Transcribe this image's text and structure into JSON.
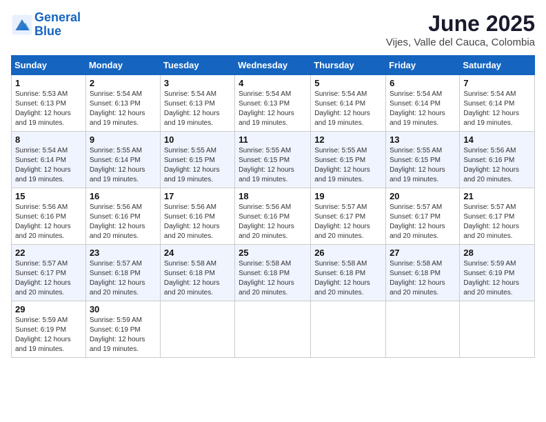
{
  "header": {
    "logo_line1": "General",
    "logo_line2": "Blue",
    "month": "June 2025",
    "location": "Vijes, Valle del Cauca, Colombia"
  },
  "weekdays": [
    "Sunday",
    "Monday",
    "Tuesday",
    "Wednesday",
    "Thursday",
    "Friday",
    "Saturday"
  ],
  "weeks": [
    [
      {
        "day": "1",
        "sunrise": "Sunrise: 5:53 AM",
        "sunset": "Sunset: 6:13 PM",
        "daylight": "Daylight: 12 hours and 19 minutes."
      },
      {
        "day": "2",
        "sunrise": "Sunrise: 5:54 AM",
        "sunset": "Sunset: 6:13 PM",
        "daylight": "Daylight: 12 hours and 19 minutes."
      },
      {
        "day": "3",
        "sunrise": "Sunrise: 5:54 AM",
        "sunset": "Sunset: 6:13 PM",
        "daylight": "Daylight: 12 hours and 19 minutes."
      },
      {
        "day": "4",
        "sunrise": "Sunrise: 5:54 AM",
        "sunset": "Sunset: 6:13 PM",
        "daylight": "Daylight: 12 hours and 19 minutes."
      },
      {
        "day": "5",
        "sunrise": "Sunrise: 5:54 AM",
        "sunset": "Sunset: 6:14 PM",
        "daylight": "Daylight: 12 hours and 19 minutes."
      },
      {
        "day": "6",
        "sunrise": "Sunrise: 5:54 AM",
        "sunset": "Sunset: 6:14 PM",
        "daylight": "Daylight: 12 hours and 19 minutes."
      },
      {
        "day": "7",
        "sunrise": "Sunrise: 5:54 AM",
        "sunset": "Sunset: 6:14 PM",
        "daylight": "Daylight: 12 hours and 19 minutes."
      }
    ],
    [
      {
        "day": "8",
        "sunrise": "Sunrise: 5:54 AM",
        "sunset": "Sunset: 6:14 PM",
        "daylight": "Daylight: 12 hours and 19 minutes."
      },
      {
        "day": "9",
        "sunrise": "Sunrise: 5:55 AM",
        "sunset": "Sunset: 6:14 PM",
        "daylight": "Daylight: 12 hours and 19 minutes."
      },
      {
        "day": "10",
        "sunrise": "Sunrise: 5:55 AM",
        "sunset": "Sunset: 6:15 PM",
        "daylight": "Daylight: 12 hours and 19 minutes."
      },
      {
        "day": "11",
        "sunrise": "Sunrise: 5:55 AM",
        "sunset": "Sunset: 6:15 PM",
        "daylight": "Daylight: 12 hours and 19 minutes."
      },
      {
        "day": "12",
        "sunrise": "Sunrise: 5:55 AM",
        "sunset": "Sunset: 6:15 PM",
        "daylight": "Daylight: 12 hours and 19 minutes."
      },
      {
        "day": "13",
        "sunrise": "Sunrise: 5:55 AM",
        "sunset": "Sunset: 6:15 PM",
        "daylight": "Daylight: 12 hours and 19 minutes."
      },
      {
        "day": "14",
        "sunrise": "Sunrise: 5:56 AM",
        "sunset": "Sunset: 6:16 PM",
        "daylight": "Daylight: 12 hours and 20 minutes."
      }
    ],
    [
      {
        "day": "15",
        "sunrise": "Sunrise: 5:56 AM",
        "sunset": "Sunset: 6:16 PM",
        "daylight": "Daylight: 12 hours and 20 minutes."
      },
      {
        "day": "16",
        "sunrise": "Sunrise: 5:56 AM",
        "sunset": "Sunset: 6:16 PM",
        "daylight": "Daylight: 12 hours and 20 minutes."
      },
      {
        "day": "17",
        "sunrise": "Sunrise: 5:56 AM",
        "sunset": "Sunset: 6:16 PM",
        "daylight": "Daylight: 12 hours and 20 minutes."
      },
      {
        "day": "18",
        "sunrise": "Sunrise: 5:56 AM",
        "sunset": "Sunset: 6:16 PM",
        "daylight": "Daylight: 12 hours and 20 minutes."
      },
      {
        "day": "19",
        "sunrise": "Sunrise: 5:57 AM",
        "sunset": "Sunset: 6:17 PM",
        "daylight": "Daylight: 12 hours and 20 minutes."
      },
      {
        "day": "20",
        "sunrise": "Sunrise: 5:57 AM",
        "sunset": "Sunset: 6:17 PM",
        "daylight": "Daylight: 12 hours and 20 minutes."
      },
      {
        "day": "21",
        "sunrise": "Sunrise: 5:57 AM",
        "sunset": "Sunset: 6:17 PM",
        "daylight": "Daylight: 12 hours and 20 minutes."
      }
    ],
    [
      {
        "day": "22",
        "sunrise": "Sunrise: 5:57 AM",
        "sunset": "Sunset: 6:17 PM",
        "daylight": "Daylight: 12 hours and 20 minutes."
      },
      {
        "day": "23",
        "sunrise": "Sunrise: 5:57 AM",
        "sunset": "Sunset: 6:18 PM",
        "daylight": "Daylight: 12 hours and 20 minutes."
      },
      {
        "day": "24",
        "sunrise": "Sunrise: 5:58 AM",
        "sunset": "Sunset: 6:18 PM",
        "daylight": "Daylight: 12 hours and 20 minutes."
      },
      {
        "day": "25",
        "sunrise": "Sunrise: 5:58 AM",
        "sunset": "Sunset: 6:18 PM",
        "daylight": "Daylight: 12 hours and 20 minutes."
      },
      {
        "day": "26",
        "sunrise": "Sunrise: 5:58 AM",
        "sunset": "Sunset: 6:18 PM",
        "daylight": "Daylight: 12 hours and 20 minutes."
      },
      {
        "day": "27",
        "sunrise": "Sunrise: 5:58 AM",
        "sunset": "Sunset: 6:18 PM",
        "daylight": "Daylight: 12 hours and 20 minutes."
      },
      {
        "day": "28",
        "sunrise": "Sunrise: 5:59 AM",
        "sunset": "Sunset: 6:19 PM",
        "daylight": "Daylight: 12 hours and 20 minutes."
      }
    ],
    [
      {
        "day": "29",
        "sunrise": "Sunrise: 5:59 AM",
        "sunset": "Sunset: 6:19 PM",
        "daylight": "Daylight: 12 hours and 19 minutes."
      },
      {
        "day": "30",
        "sunrise": "Sunrise: 5:59 AM",
        "sunset": "Sunset: 6:19 PM",
        "daylight": "Daylight: 12 hours and 19 minutes."
      },
      null,
      null,
      null,
      null,
      null
    ]
  ]
}
